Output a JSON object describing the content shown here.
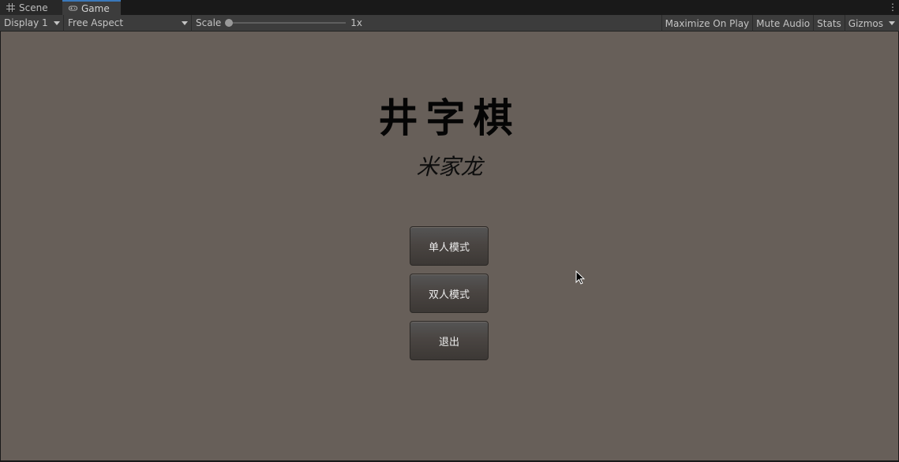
{
  "tabs": [
    {
      "label": "Scene",
      "icon": "grid-icon"
    },
    {
      "label": "Game",
      "icon": "gamepad-icon",
      "active": true
    }
  ],
  "toolbar": {
    "display": "Display 1",
    "aspect": "Free Aspect",
    "scale_label": "Scale",
    "scale_value": "1x",
    "scale_fraction": 0.0,
    "maximize": "Maximize On Play",
    "mute": "Mute Audio",
    "stats": "Stats",
    "gizmos": "Gizmos"
  },
  "game": {
    "title": "井字棋",
    "subtitle": "米家龙",
    "buttons": [
      "单人模式",
      "双人模式",
      "退出"
    ],
    "background": "#675f59"
  },
  "colors": {
    "accent": "#3a79bb",
    "toolbar": "#3c3c3c"
  }
}
